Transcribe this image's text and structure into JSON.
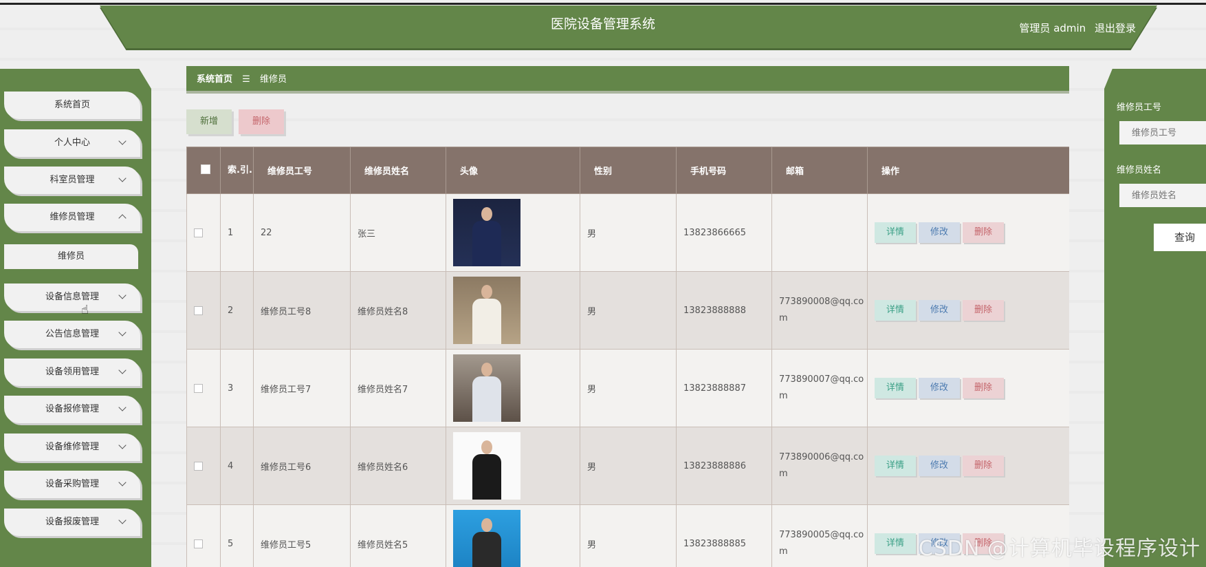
{
  "header": {
    "title": "医院设备管理系统",
    "user_label": "管理员 admin",
    "logout": "退出登录"
  },
  "sidebar": {
    "items": [
      {
        "label": "系统首页"
      },
      {
        "label": "个人中心"
      },
      {
        "label": "科室员管理"
      },
      {
        "label": "维修员管理"
      },
      {
        "label": "维修员"
      },
      {
        "label": "设备信息管理"
      },
      {
        "label": "公告信息管理"
      },
      {
        "label": "设备领用管理"
      },
      {
        "label": "设备报修管理"
      },
      {
        "label": "设备维修管理"
      },
      {
        "label": "设备采购管理"
      },
      {
        "label": "设备报废管理"
      }
    ]
  },
  "breadcrumb": {
    "home": "系统首页",
    "separator": "☰",
    "current": "维修员"
  },
  "toolbar": {
    "add_label": "新增",
    "delete_label": "删除"
  },
  "table": {
    "headers": [
      "索.引.",
      "维修员工号",
      "维修员姓名",
      "头像",
      "性别",
      "手机号码",
      "邮箱",
      "操作"
    ],
    "rows": [
      {
        "index": "1",
        "id": "22",
        "name": "张三",
        "gender": "男",
        "phone": "13823866665",
        "email": ""
      },
      {
        "index": "2",
        "id": "维修员工号8",
        "name": "维修员姓名8",
        "gender": "男",
        "phone": "13823888888",
        "email": "773890008@qq.com"
      },
      {
        "index": "3",
        "id": "维修员工号7",
        "name": "维修员姓名7",
        "gender": "男",
        "phone": "13823888887",
        "email": "773890007@qq.com"
      },
      {
        "index": "4",
        "id": "维修员工号6",
        "name": "维修员姓名6",
        "gender": "男",
        "phone": "13823888886",
        "email": "773890006@qq.com"
      },
      {
        "index": "5",
        "id": "维修员工号5",
        "name": "维修员姓名5",
        "gender": "男",
        "phone": "13823888885",
        "email": "773890005@qq.com"
      }
    ],
    "actions": {
      "detail": "详情",
      "edit": "修改",
      "delete": "删除"
    }
  },
  "search": {
    "id_label": "维修员工号",
    "id_placeholder": "维修员工号",
    "name_label": "维修员姓名",
    "name_placeholder": "维修员姓名",
    "button": "查询"
  },
  "watermark": "CSDN @计算机毕设程序设计",
  "colors": {
    "accent_green": "#638649",
    "table_header": "#85736b"
  }
}
